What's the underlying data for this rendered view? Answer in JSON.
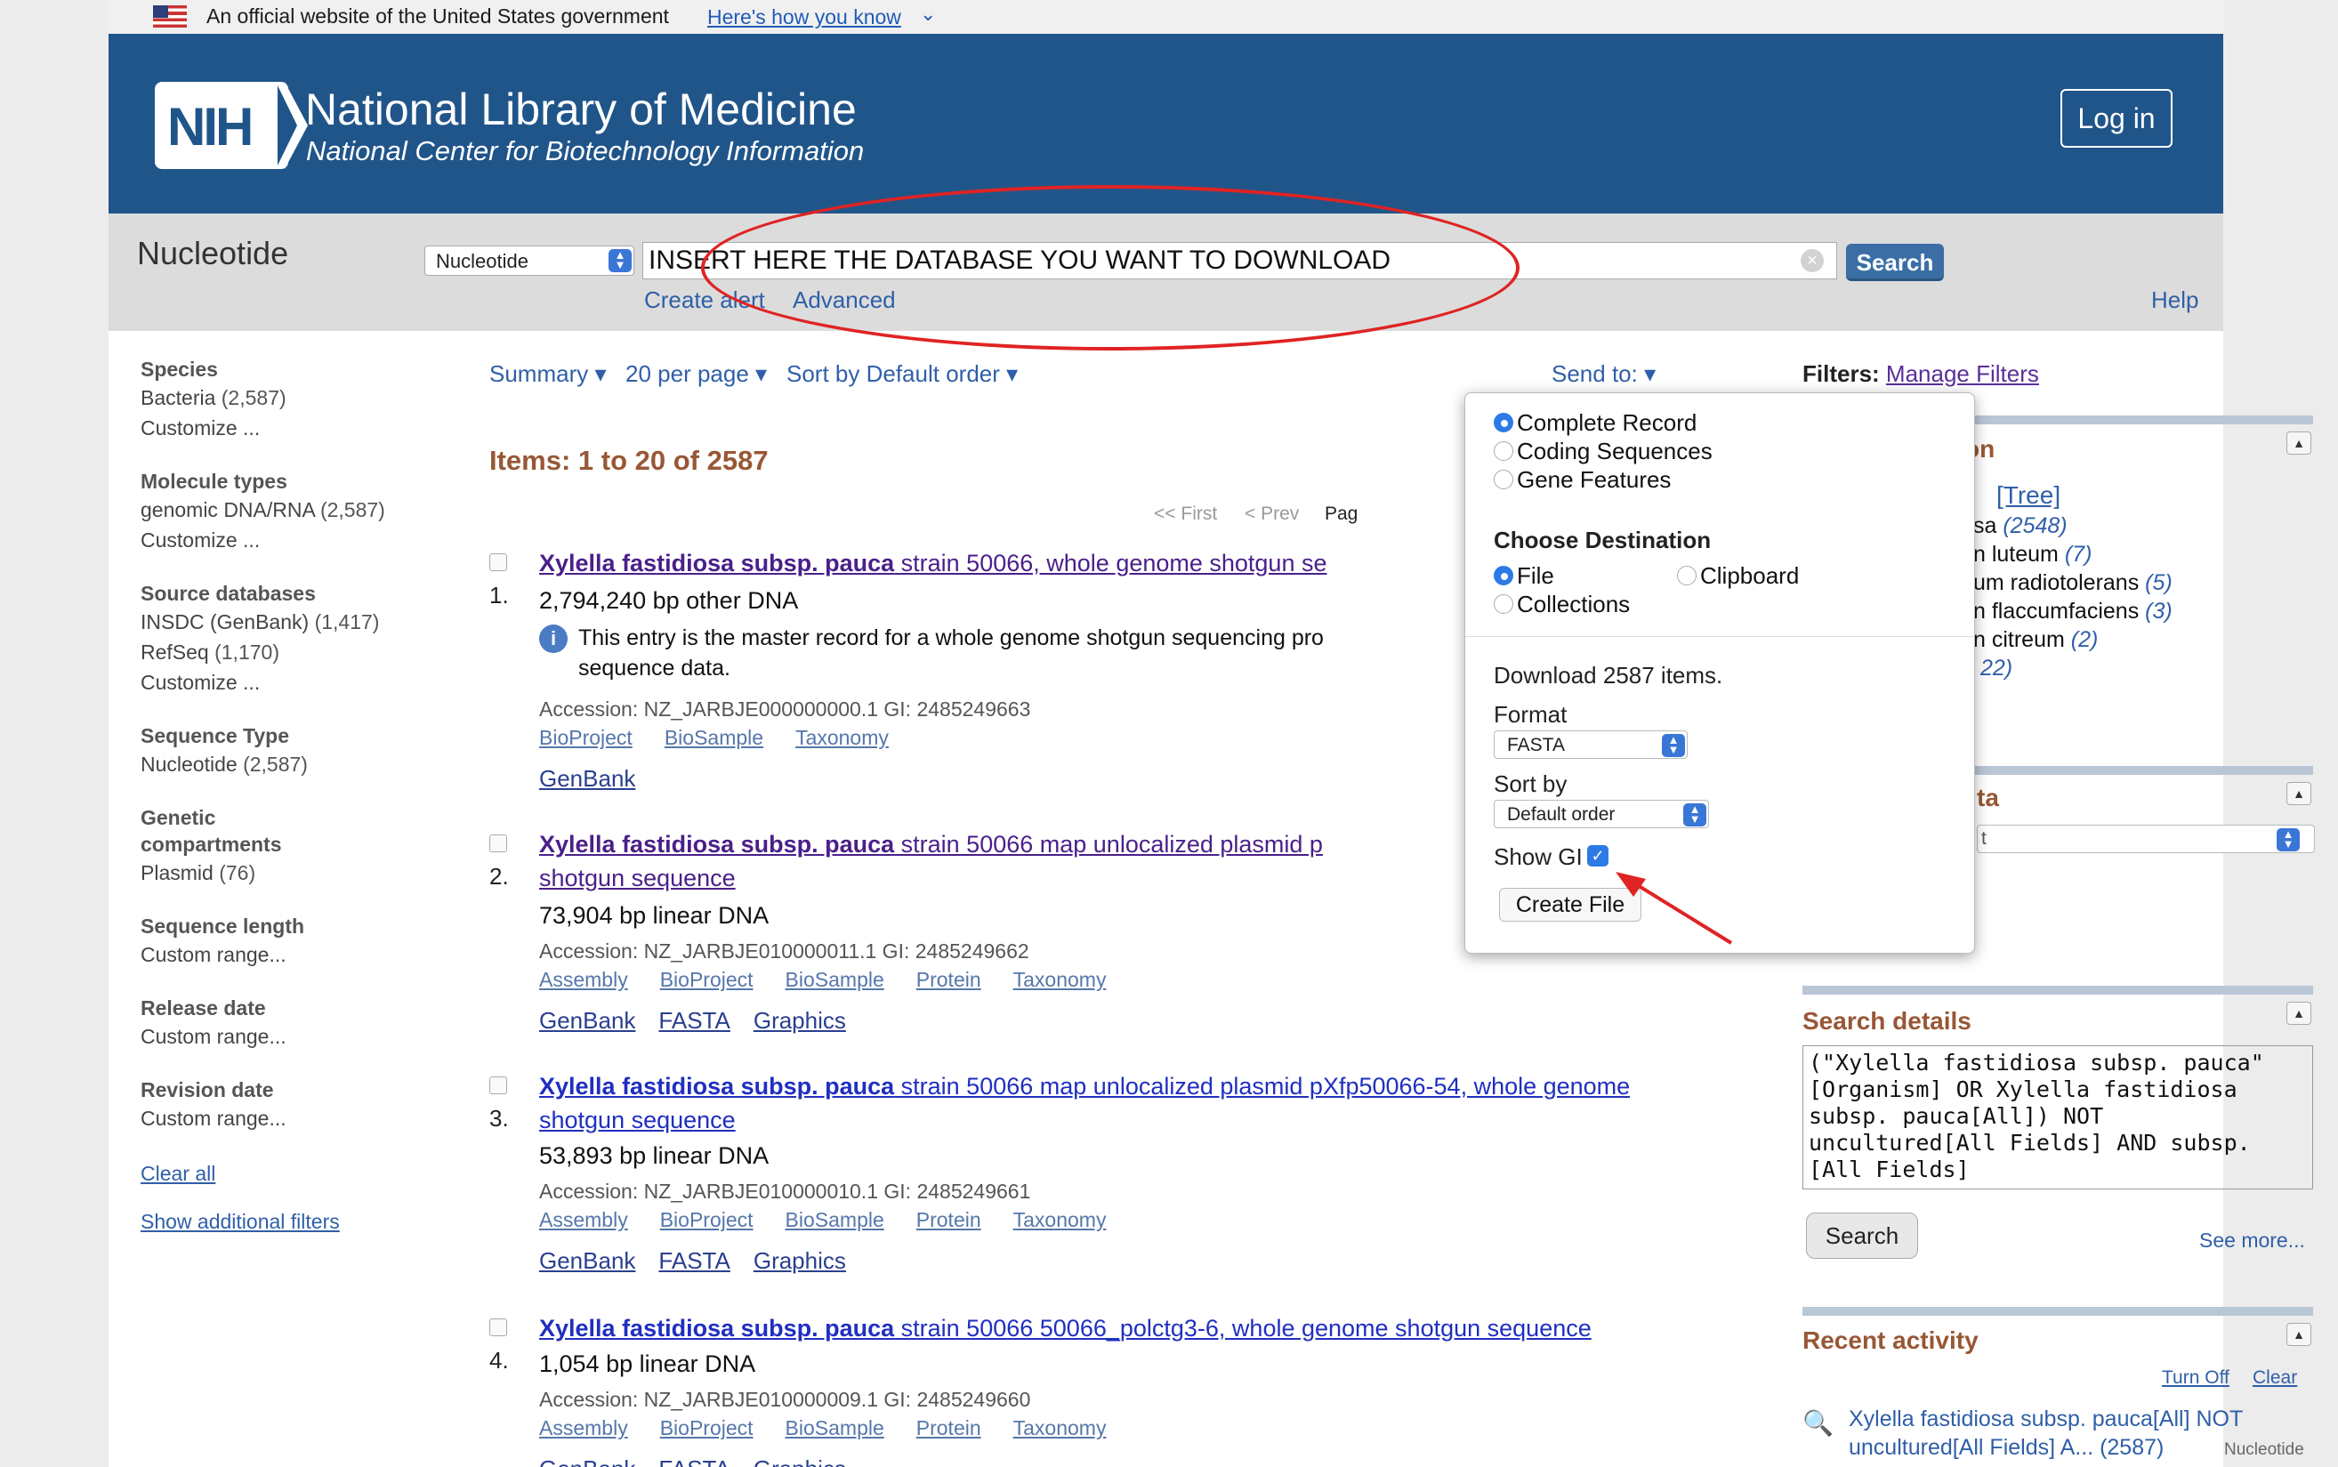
{
  "gov_banner": {
    "text": "An official website of the United States government",
    "link": "Here's how you know"
  },
  "header": {
    "logo_text": "NIH",
    "title": "National Library of Medicine",
    "subtitle": "National Center for Biotechnology Information",
    "login": "Log in"
  },
  "search": {
    "db_label": "Nucleotide",
    "db_select": "Nucleotide",
    "query": "INSERT HERE THE DATABASE YOU WANT TO DOWNLOAD",
    "button": "Search",
    "create_alert": "Create alert",
    "advanced": "Advanced",
    "help": "Help"
  },
  "annotation_color": "#e02323",
  "sidebar": {
    "facets": [
      {
        "title": "Species",
        "items": [
          {
            "label": "Bacteria",
            "count": "(2,587)"
          }
        ],
        "customize": "Customize ..."
      },
      {
        "title": "Molecule types",
        "items": [
          {
            "label": "genomic DNA/RNA",
            "count": "(2,587)"
          }
        ],
        "customize": "Customize ..."
      },
      {
        "title": "Source databases",
        "items": [
          {
            "label": "INSDC (GenBank)",
            "count": "(1,417)"
          },
          {
            "label": "RefSeq",
            "count": "(1,170)"
          }
        ],
        "customize": "Customize ..."
      },
      {
        "title": "Sequence Type",
        "items": [
          {
            "label": "Nucleotide",
            "count": "(2,587)"
          }
        ]
      },
      {
        "title_line1": "Genetic",
        "title_line2": "compartments",
        "items": [
          {
            "label": "Plasmid",
            "count": "(76)"
          }
        ]
      },
      {
        "title": "Sequence length",
        "range": "Custom range..."
      },
      {
        "title": "Release date",
        "range": "Custom range..."
      },
      {
        "title": "Revision date",
        "range": "Custom range..."
      }
    ],
    "clear_all": "Clear all",
    "show_additional": "Show additional filters"
  },
  "toolbar": {
    "summary": "Summary",
    "per_page": "20 per page",
    "sort": "Sort by Default order",
    "send_to": "Send to:"
  },
  "items_label": "Items: 1 to 20 of 2587",
  "pager": {
    "first": "<< First",
    "prev": "< Prev",
    "page": "Pag"
  },
  "results": [
    {
      "num": "1.",
      "title_bold": "Xylella fastidiosa subsp. pauca",
      "title_rest": " strain 50066, whole genome shotgun se",
      "desc": "2,794,240 bp other DNA",
      "info_line1": "This entry is the master record for a whole genome shotgun sequencing pro",
      "info_line2": "sequence data.",
      "accession": "Accession: NZ_JARBJE000000000.1   GI: 2485249663",
      "links": [
        "BioProject",
        "BioSample",
        "Taxonomy"
      ],
      "links2": [
        "GenBank"
      ]
    },
    {
      "num": "2.",
      "title_bold": "Xylella fastidiosa subsp. pauca",
      "title_rest": " strain 50066 map unlocalized plasmid p",
      "title_line2": "shotgun sequence",
      "desc": "73,904 bp linear DNA",
      "accession": "Accession: NZ_JARBJE010000011.1   GI: 2485249662",
      "links": [
        "Assembly",
        "BioProject",
        "BioSample",
        "Protein",
        "Taxonomy"
      ],
      "links2": [
        "GenBank",
        "FASTA",
        "Graphics"
      ]
    },
    {
      "num": "3.",
      "title_bold": "Xylella fastidiosa subsp. pauca",
      "title_rest": " strain 50066 map unlocalized plasmid pXfp50066-54, whole genome",
      "title_line2": "shotgun sequence",
      "desc": "53,893 bp linear DNA",
      "accession": "Accession: NZ_JARBJE010000010.1   GI: 2485249661",
      "links": [
        "Assembly",
        "BioProject",
        "BioSample",
        "Protein",
        "Taxonomy"
      ],
      "links2": [
        "GenBank",
        "FASTA",
        "Graphics"
      ]
    },
    {
      "num": "4.",
      "title_bold": "Xylella fastidiosa subsp. pauca",
      "title_rest": " strain 50066 50066_polctg3-6, whole genome shotgun sequence",
      "desc": "1,054 bp linear DNA",
      "accession": "Accession: NZ_JARBJE010000009.1   GI: 2485249660",
      "links": [
        "Assembly",
        "BioProject",
        "BioSample",
        "Protein",
        "Taxonomy"
      ],
      "links2": [
        "GenBank",
        "FASTA",
        "Graphics"
      ]
    }
  ],
  "right": {
    "filters_label": "Filters:",
    "manage_filters": "Manage Filters",
    "taxonomy_title_frag": "on",
    "tree": "[Tree]",
    "tax_items": [
      {
        "name": "sa",
        "count": "(2548)"
      },
      {
        "name": "n luteum",
        "count": "(7)"
      },
      {
        "name": "um radiotolerans",
        "count": "(5)"
      },
      {
        "name": "n flaccumfaciens",
        "count": "(3)"
      },
      {
        "name": "n citreum",
        "count": "(2)"
      },
      {
        "name": "",
        "count": "22)"
      }
    ],
    "related_title_frag": "ta",
    "related_select_frag": "t",
    "search_details_title": "Search details",
    "search_details_text": "(\"Xylella fastidiosa subsp. pauca\"\n[Organism] OR Xylella fastidiosa\nsubsp. pauca[All]) NOT\nuncultured[All Fields] AND subsp.\n[All Fields]",
    "search_button": "Search",
    "see_more": "See more...",
    "recent_title": "Recent activity",
    "turn_off": "Turn Off",
    "clear": "Clear",
    "recent_item_line1": "Xylella fastidiosa subsp. pauca[All] NOT",
    "recent_item_line2": "uncultured[All Fields] A... (2587)",
    "recent_db": "Nucleotide"
  },
  "send_to_popup": {
    "scope_options": [
      {
        "label": "Complete Record",
        "selected": true
      },
      {
        "label": "Coding Sequences",
        "selected": false
      },
      {
        "label": "Gene Features",
        "selected": false
      }
    ],
    "destination_title": "Choose Destination",
    "destinations": [
      {
        "label": "File",
        "selected": true
      },
      {
        "label": "Clipboard",
        "selected": false
      },
      {
        "label": "Collections",
        "selected": false
      }
    ],
    "download_text": "Download 2587 items.",
    "format_label": "Format",
    "format_value": "FASTA",
    "sort_label": "Sort by",
    "sort_value": "Default order",
    "show_gi_label": "Show GI",
    "show_gi_checked": true,
    "create_file": "Create File"
  }
}
